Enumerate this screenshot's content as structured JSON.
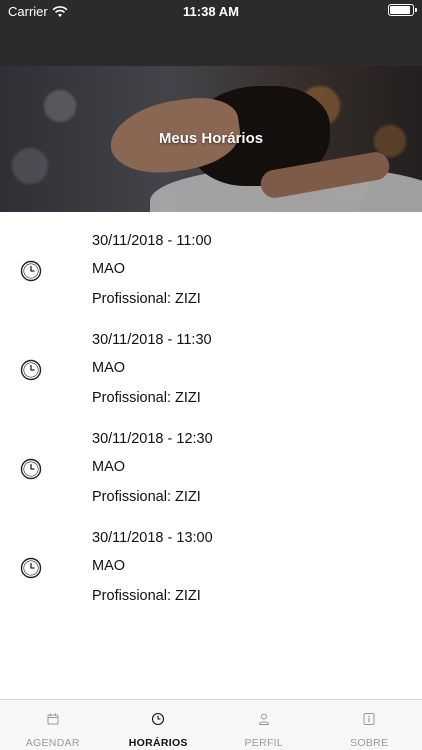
{
  "status_bar": {
    "carrier": "Carrier",
    "time": "11:38 AM"
  },
  "hero": {
    "title": "Meus Horários"
  },
  "appointments": [
    {
      "datetime": "30/11/2018 - 11:00",
      "service": "MAO",
      "professional": "Profissional: ZIZI"
    },
    {
      "datetime": "30/11/2018 - 11:30",
      "service": "MAO",
      "professional": "Profissional: ZIZI"
    },
    {
      "datetime": "30/11/2018 - 12:30",
      "service": "MAO",
      "professional": "Profissional: ZIZI"
    },
    {
      "datetime": "30/11/2018 - 13:00",
      "service": "MAO",
      "professional": "Profissional: ZIZI"
    }
  ],
  "tabs": [
    {
      "label": "AGENDAR",
      "icon": "calendar-icon"
    },
    {
      "label": "HORÁRIOS",
      "icon": "clock-icon",
      "active": true
    },
    {
      "label": "PERFIL",
      "icon": "user-icon"
    },
    {
      "label": "SOBRE",
      "icon": "info-icon"
    }
  ],
  "colors": {
    "nav_bg": "#2b2b2b",
    "tab_active": "#111111",
    "tab_inactive": "#9a9a9a"
  }
}
